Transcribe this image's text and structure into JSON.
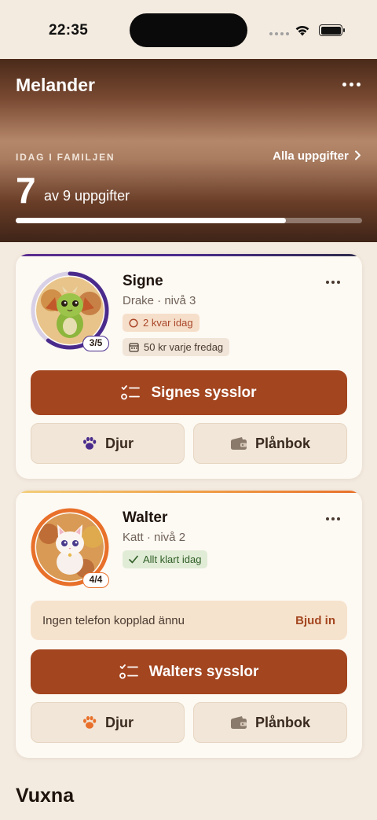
{
  "status_bar": {
    "time": "22:35"
  },
  "header": {
    "family_name": "Melander",
    "today_label": "IDAG I FAMILJEN",
    "all_tasks_link": "Alla uppgifter",
    "done_count": "7",
    "count_text": "av 9 uppgifter",
    "progress": 0.78
  },
  "children": [
    {
      "name": "Signe",
      "subtitle": "Drake · nivå 3",
      "level_progress": "3/5",
      "ring_color": "#4a2b8c",
      "status_pill": "2 kvar idag",
      "allowance_pill": "50 kr varje fredag",
      "chores_button": "Signes sysslor",
      "pet_button": "Djur",
      "wallet_button": "Plånbok",
      "paw_color": "#4a2b8c"
    },
    {
      "name": "Walter",
      "subtitle": "Katt · nivå 2",
      "level_progress": "4/4",
      "ring_color": "#e8702a",
      "status_pill": "Allt klart idag",
      "invite_text": "Ingen telefon kopplad ännu",
      "invite_link": "Bjud in",
      "chores_button": "Walters sysslor",
      "pet_button": "Djur",
      "wallet_button": "Plånbok",
      "paw_color": "#e8702a"
    }
  ],
  "adults_heading": "Vuxna",
  "colors": {
    "accent": "#a3451f",
    "background": "#f4ebe0",
    "card": "#fdf9f3"
  }
}
